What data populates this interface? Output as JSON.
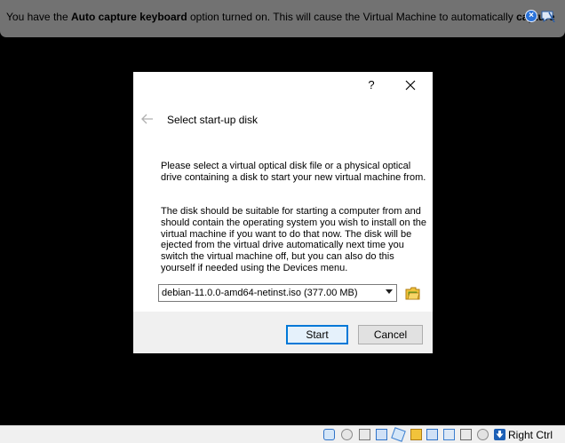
{
  "notification": {
    "text_1": "You have the ",
    "bold_1": "Auto capture keyboard",
    "text_2": " option turned on. This will cause the Virtual Machine to automatically ",
    "bold_2": "capture",
    "close_icon": "×"
  },
  "dialog": {
    "help_label": "?",
    "title": "Select start-up disk",
    "paragraph_1": "Please select a virtual optical disk file or a physical optical drive containing a disk to start your new virtual machine from.",
    "paragraph_2": "The disk should be suitable for starting a computer from and should contain the operating system you wish to install on the virtual machine if you want to do that now. The disk will be ejected from the virtual drive automatically next time you switch the virtual machine off, but you can also do this yourself if needed using the Devices menu.",
    "disk_selection": "debian-11.0.0-amd64-netinst.iso (377.00 MB)",
    "start_label": "Start",
    "cancel_label": "Cancel"
  },
  "statusbar": {
    "icons": [
      "hard-disk-icon",
      "optical-drive-icon",
      "audio-icon",
      "network-icon",
      "usb-icon",
      "shared-folders-icon",
      "display-icon",
      "video-capture-icon",
      "cpu-icon",
      "mouse-integration-icon",
      "host-key-arrow-icon"
    ],
    "host_key": "Right Ctrl"
  }
}
